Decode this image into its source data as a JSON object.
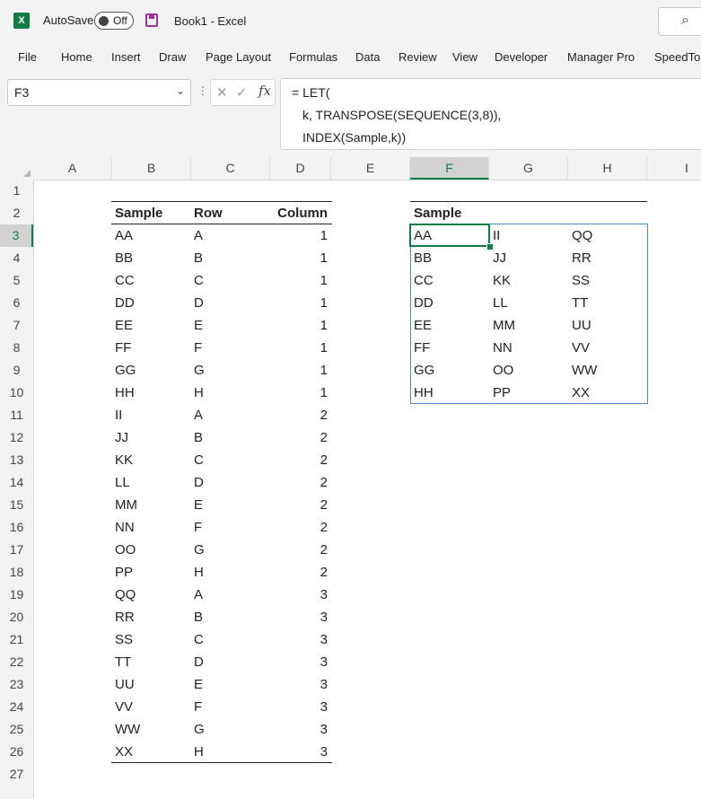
{
  "titlebar": {
    "autosave_label": "AutoSave",
    "autosave_state": "Off",
    "document_title": "Book1  -  Excel",
    "excel_logo_letter": "X",
    "search_glyph": "⌕"
  },
  "ribbon": {
    "tabs": [
      "File",
      "Home",
      "Insert",
      "Draw",
      "Page Layout",
      "Formulas",
      "Data",
      "Review",
      "View",
      "Developer",
      "Manager Pro",
      "SpeedTo"
    ]
  },
  "formula_bar": {
    "name_box": "F3",
    "fx_label": "fx",
    "cancel_glyph": "✕",
    "enter_glyph": "✓",
    "formula_lines": [
      "= LET(",
      "k, TRANSPOSE(SEQUENCE(3,8)),",
      "INDEX(Sample,k))"
    ]
  },
  "grid": {
    "columns": [
      "A",
      "B",
      "C",
      "D",
      "E",
      "F",
      "G",
      "H",
      "I"
    ],
    "rows": [
      "1",
      "2",
      "3",
      "4",
      "5",
      "6",
      "7",
      "8",
      "9",
      "10",
      "11",
      "12",
      "13",
      "14",
      "15",
      "16",
      "17",
      "18",
      "19",
      "20",
      "21",
      "22",
      "23",
      "24",
      "25",
      "26",
      "27"
    ],
    "active_column": "F",
    "active_row": "3"
  },
  "left_table": {
    "headers": [
      "Sample",
      "Row",
      "Column"
    ],
    "rows": [
      [
        "AA",
        "A",
        "1"
      ],
      [
        "BB",
        "B",
        "1"
      ],
      [
        "CC",
        "C",
        "1"
      ],
      [
        "DD",
        "D",
        "1"
      ],
      [
        "EE",
        "E",
        "1"
      ],
      [
        "FF",
        "F",
        "1"
      ],
      [
        "GG",
        "G",
        "1"
      ],
      [
        "HH",
        "H",
        "1"
      ],
      [
        "II",
        "A",
        "2"
      ],
      [
        "JJ",
        "B",
        "2"
      ],
      [
        "KK",
        "C",
        "2"
      ],
      [
        "LL",
        "D",
        "2"
      ],
      [
        "MM",
        "E",
        "2"
      ],
      [
        "NN",
        "F",
        "2"
      ],
      [
        "OO",
        "G",
        "2"
      ],
      [
        "PP",
        "H",
        "2"
      ],
      [
        "QQ",
        "A",
        "3"
      ],
      [
        "RR",
        "B",
        "3"
      ],
      [
        "SS",
        "C",
        "3"
      ],
      [
        "TT",
        "D",
        "3"
      ],
      [
        "UU",
        "E",
        "3"
      ],
      [
        "VV",
        "F",
        "3"
      ],
      [
        "WW",
        "G",
        "3"
      ],
      [
        "XX",
        "H",
        "3"
      ]
    ]
  },
  "right_table": {
    "header": "Sample",
    "rows": [
      [
        "AA",
        "II",
        "QQ"
      ],
      [
        "BB",
        "JJ",
        "RR"
      ],
      [
        "CC",
        "KK",
        "SS"
      ],
      [
        "DD",
        "LL",
        "TT"
      ],
      [
        "EE",
        "MM",
        "UU"
      ],
      [
        "FF",
        "NN",
        "VV"
      ],
      [
        "GG",
        "OO",
        "WW"
      ],
      [
        "HH",
        "PP",
        "XX"
      ]
    ]
  }
}
